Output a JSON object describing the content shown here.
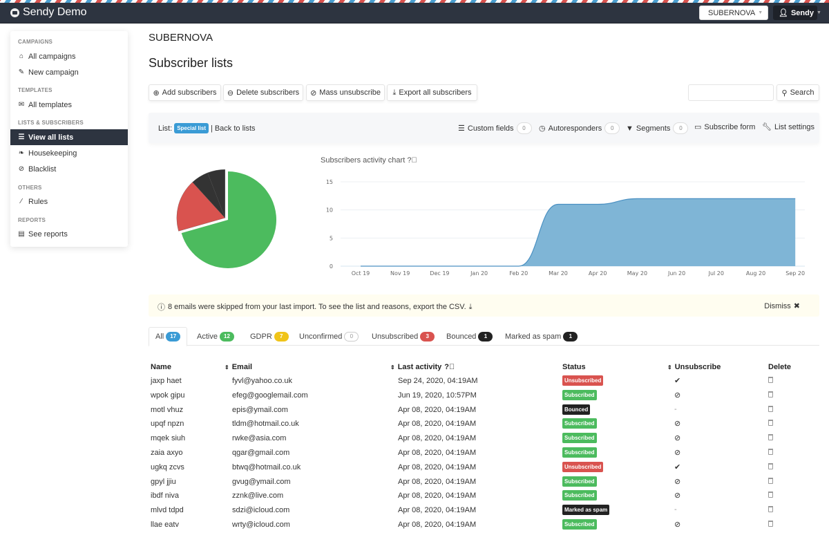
{
  "navbar": {
    "app_title": "Sendy Demo",
    "brand_selector": "SUBERNOVA",
    "user_menu": "Sendy"
  },
  "sidebar": {
    "sections": [
      {
        "header": "CAMPAIGNS",
        "items": [
          {
            "label": "All campaigns",
            "icon": "home-icon"
          },
          {
            "label": "New campaign",
            "icon": "edit-icon"
          }
        ]
      },
      {
        "header": "TEMPLATES",
        "items": [
          {
            "label": "All templates",
            "icon": "envelope-icon"
          }
        ]
      },
      {
        "header": "LISTS & SUBSCRIBERS",
        "items": [
          {
            "label": "View all lists",
            "icon": "list-icon",
            "active": true
          },
          {
            "label": "Housekeeping",
            "icon": "leaf-icon"
          },
          {
            "label": "Blacklist",
            "icon": "ban-icon"
          }
        ]
      },
      {
        "header": "OTHERS",
        "items": [
          {
            "label": "Rules",
            "icon": "magic-wand-icon"
          }
        ]
      },
      {
        "header": "REPORTS",
        "items": [
          {
            "label": "See reports",
            "icon": "bar-chart-icon"
          }
        ]
      }
    ]
  },
  "main": {
    "brand_name": "SUBERNOVA",
    "page_title": "Subscriber lists",
    "actions": {
      "add": "Add subscribers",
      "delete": "Delete subscribers",
      "mass_unsubscribe": "Mass unsubscribe",
      "export": "Export all subscribers"
    },
    "search": {
      "placeholder": "",
      "value": "",
      "button": "Search"
    },
    "list_bar": {
      "list_label": "List:",
      "list_name": "Special list",
      "back_link": "Back to lists",
      "custom_fields": "Custom fields",
      "custom_fields_count": "0",
      "autoresponders": "Autoresponders",
      "autoresponders_count": "0",
      "segments": "Segments",
      "segments_count": "0",
      "subscribe_form": "Subscribe form",
      "list_settings": "List settings"
    },
    "alert": {
      "text": "8 emails were skipped from your last import. To see the list and reasons, export the CSV.",
      "dismiss": "Dismiss"
    },
    "tabs": [
      {
        "label": "All",
        "count": "17",
        "color": "#3a9bd5",
        "active": true
      },
      {
        "label": "Active",
        "count": "12",
        "color": "#4cbb5e"
      },
      {
        "label": "GDPR",
        "count": "7",
        "color": "#f0c419"
      },
      {
        "label": "Unconfirmed",
        "count": "0",
        "color": "outline"
      },
      {
        "label": "Unsubscribed",
        "count": "3",
        "color": "#d9534f"
      },
      {
        "label": "Bounced",
        "count": "1",
        "color": "#222222"
      },
      {
        "label": "Marked as spam",
        "count": "1",
        "color": "#222222"
      }
    ],
    "table": {
      "headers": {
        "name": "Name",
        "email": "Email",
        "last_activity": "Last activity",
        "status": "Status",
        "unsubscribe": "Unsubscribe",
        "delete": "Delete"
      },
      "rows": [
        {
          "name": "jaxp haet",
          "email": "fyvl@yahoo.co.uk",
          "last_activity": "Sep 24, 2020, 04:19AM",
          "status": "Unsubscribed",
          "unsub": "check"
        },
        {
          "name": "wpok gipu",
          "email": "efeg@googlemail.com",
          "last_activity": "Jun 19, 2020, 10:57PM",
          "status": "Subscribed",
          "unsub": "ban"
        },
        {
          "name": "motl vhuz",
          "email": "epis@ymail.com",
          "last_activity": "Apr 08, 2020, 04:19AM",
          "status": "Bounced",
          "unsub": "-"
        },
        {
          "name": "upqf npzn",
          "email": "tldm@hotmail.co.uk",
          "last_activity": "Apr 08, 2020, 04:19AM",
          "status": "Subscribed",
          "unsub": "ban"
        },
        {
          "name": "mqek siuh",
          "email": "rwke@asia.com",
          "last_activity": "Apr 08, 2020, 04:19AM",
          "status": "Subscribed",
          "unsub": "ban"
        },
        {
          "name": "zaia axyo",
          "email": "qgar@gmail.com",
          "last_activity": "Apr 08, 2020, 04:19AM",
          "status": "Subscribed",
          "unsub": "ban"
        },
        {
          "name": "ugkq zcvs",
          "email": "btwq@hotmail.co.uk",
          "last_activity": "Apr 08, 2020, 04:19AM",
          "status": "Unsubscribed",
          "unsub": "check"
        },
        {
          "name": "gpyl jjiu",
          "email": "gvug@ymail.com",
          "last_activity": "Apr 08, 2020, 04:19AM",
          "status": "Subscribed",
          "unsub": "ban"
        },
        {
          "name": "ibdf niva",
          "email": "zznk@live.com",
          "last_activity": "Apr 08, 2020, 04:19AM",
          "status": "Subscribed",
          "unsub": "ban"
        },
        {
          "name": "mlvd tdpd",
          "email": "sdzi@icloud.com",
          "last_activity": "Apr 08, 2020, 04:19AM",
          "status": "Marked as spam",
          "unsub": "-"
        },
        {
          "name": "llae eatv",
          "email": "wrty@icloud.com",
          "last_activity": "Apr 08, 2020, 04:19AM",
          "status": "Subscribed",
          "unsub": "ban"
        }
      ]
    },
    "status_colors": {
      "Subscribed": "#4cbb5e",
      "Unsubscribed": "#d9534f",
      "Bounced": "#222222",
      "Marked as spam": "#222222"
    }
  },
  "chart_data": [
    {
      "type": "pie",
      "title": "",
      "slices": [
        {
          "label": "Active",
          "value": 12,
          "color": "#4cbb5e"
        },
        {
          "label": "Unsubscribed",
          "value": 3,
          "color": "#d9534f"
        },
        {
          "label": "Bounced",
          "value": 1,
          "color": "#333333"
        },
        {
          "label": "Marked as spam",
          "value": 1,
          "color": "#333333"
        }
      ]
    },
    {
      "type": "area",
      "title": "Subscribers activity chart",
      "xlabel": "",
      "ylabel": "",
      "x": [
        "Oct 19",
        "Nov 19",
        "Dec 19",
        "Jan 20",
        "Feb 20",
        "Mar 20",
        "Apr 20",
        "May 20",
        "Jun 20",
        "Jul 20",
        "Aug 20",
        "Sep 20"
      ],
      "series": [
        {
          "name": "Subscribers",
          "values": [
            0,
            0,
            0,
            0,
            0,
            11,
            11,
            12,
            12,
            12,
            12,
            12
          ],
          "color": "#7fb5d6"
        }
      ],
      "yticks": [
        0,
        5,
        10,
        15
      ],
      "ylim": [
        0,
        15
      ],
      "grid": true
    }
  ]
}
